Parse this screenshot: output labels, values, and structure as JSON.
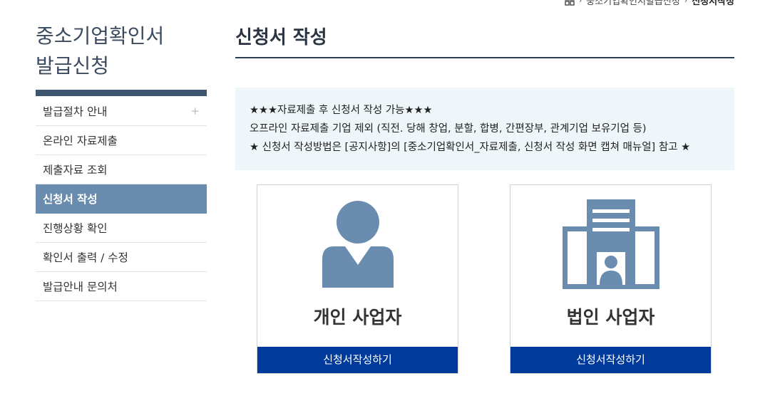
{
  "breadcrumb": {
    "items": [
      "중소기업확인서발급신청",
      "신청서작성"
    ]
  },
  "sidebar": {
    "title_line1": "중소기업확인서",
    "title_line2": "발급신청",
    "items": [
      {
        "label": "발급절차 안내",
        "has_plus": true
      },
      {
        "label": "온라인 자료제출"
      },
      {
        "label": "제출자료 조회"
      },
      {
        "label": "신청서 작성",
        "active": true
      },
      {
        "label": "진행상황 확인"
      },
      {
        "label": "확인서 출력 / 수정"
      },
      {
        "label": "발급안내 문의처"
      }
    ],
    "plus_symbol": "+"
  },
  "main": {
    "title": "신청서 작성",
    "notice": {
      "line1": "★★★자료제출 후 신청서 작성 가능★★★",
      "line2": "오프라인 자료제출 기업 제외 (직전. 당해 창업, 분할, 합병, 간편장부, 관계기업 보유기업 등)",
      "line3": "★ 신청서 작성방법은 [공지사항]의 [중소기업확인서_자료제출, 신청서 작성 화면 캡쳐 매뉴얼] 참고 ★"
    },
    "cards": [
      {
        "label": "개인 사업자",
        "button": "신청서작성하기",
        "icon": "person-icon"
      },
      {
        "label": "법인 사업자",
        "button": "신청서작성하기",
        "icon": "building-icon"
      }
    ]
  },
  "colors": {
    "sidebar_active": "#6a8cae",
    "sidebar_bar": "#3e5572",
    "button_blue": "#003b9c",
    "notice_bg": "#eef6f9",
    "icon_blue": "#6a8cae"
  }
}
